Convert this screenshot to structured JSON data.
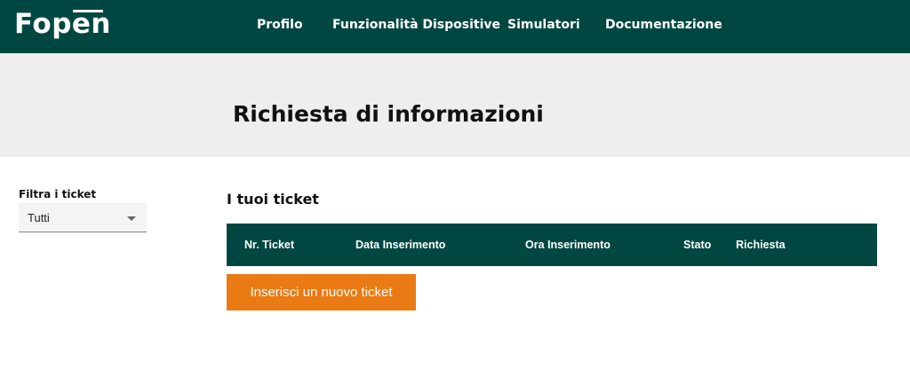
{
  "brand": {
    "logo_text": "Fopen"
  },
  "nav": {
    "items": [
      {
        "label": "Profilo"
      },
      {
        "label": "Funzionalità Dispositive"
      },
      {
        "label": "Simulatori"
      },
      {
        "label": "Documentazione"
      }
    ]
  },
  "hero": {
    "title": "Richiesta di informazioni"
  },
  "filter": {
    "label": "Filtra i ticket",
    "selected": "Tutti"
  },
  "tickets": {
    "title": "I tuoi ticket",
    "columns": [
      "Nr. Ticket",
      "Data Inserimento",
      "Ora Inserimento",
      "Stato",
      "Richiesta"
    ],
    "rows": [],
    "new_button": "Inserisci un nuovo ticket"
  },
  "colors": {
    "primary": "#004742",
    "accent": "#ea7a13",
    "hero_bg": "#efeeec"
  }
}
